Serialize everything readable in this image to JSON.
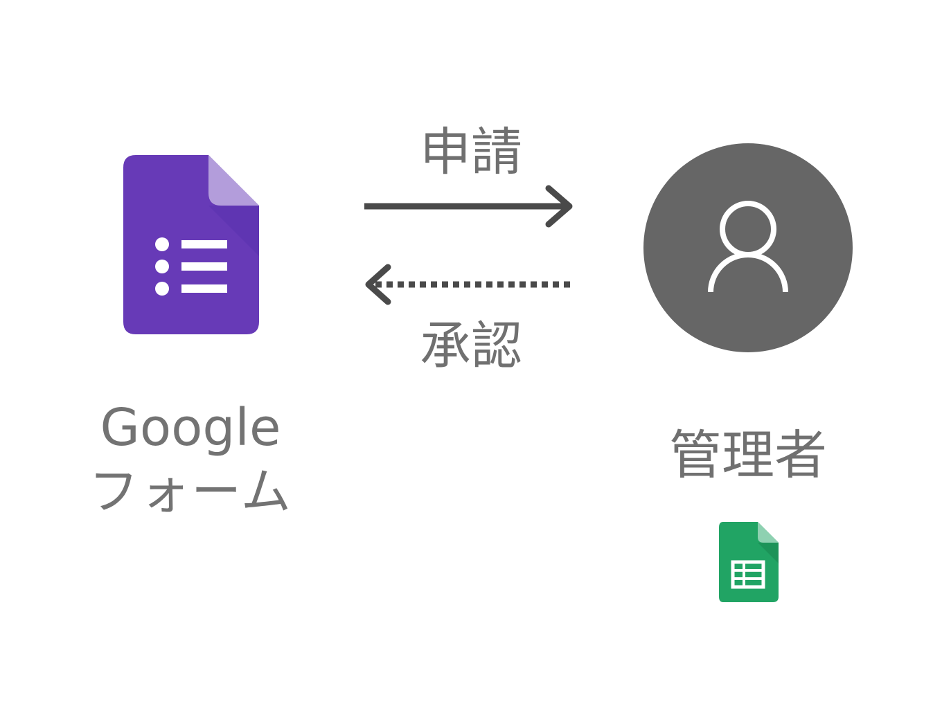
{
  "source": {
    "label_line1": "Google",
    "label_line2": "フォーム",
    "icon": "google-forms-icon",
    "color": "#673AB7"
  },
  "flows": {
    "request": {
      "label": "申請",
      "direction": "right",
      "line_style": "solid"
    },
    "approve": {
      "label": "承認",
      "direction": "left",
      "line_style": "dotted"
    },
    "arrow_color": "#4A4A4A"
  },
  "target": {
    "label": "管理者",
    "icon": "user-avatar-icon",
    "avatar_color": "#666666",
    "secondary_icon": "google-sheets-icon",
    "sheets_color": "#21A464"
  }
}
